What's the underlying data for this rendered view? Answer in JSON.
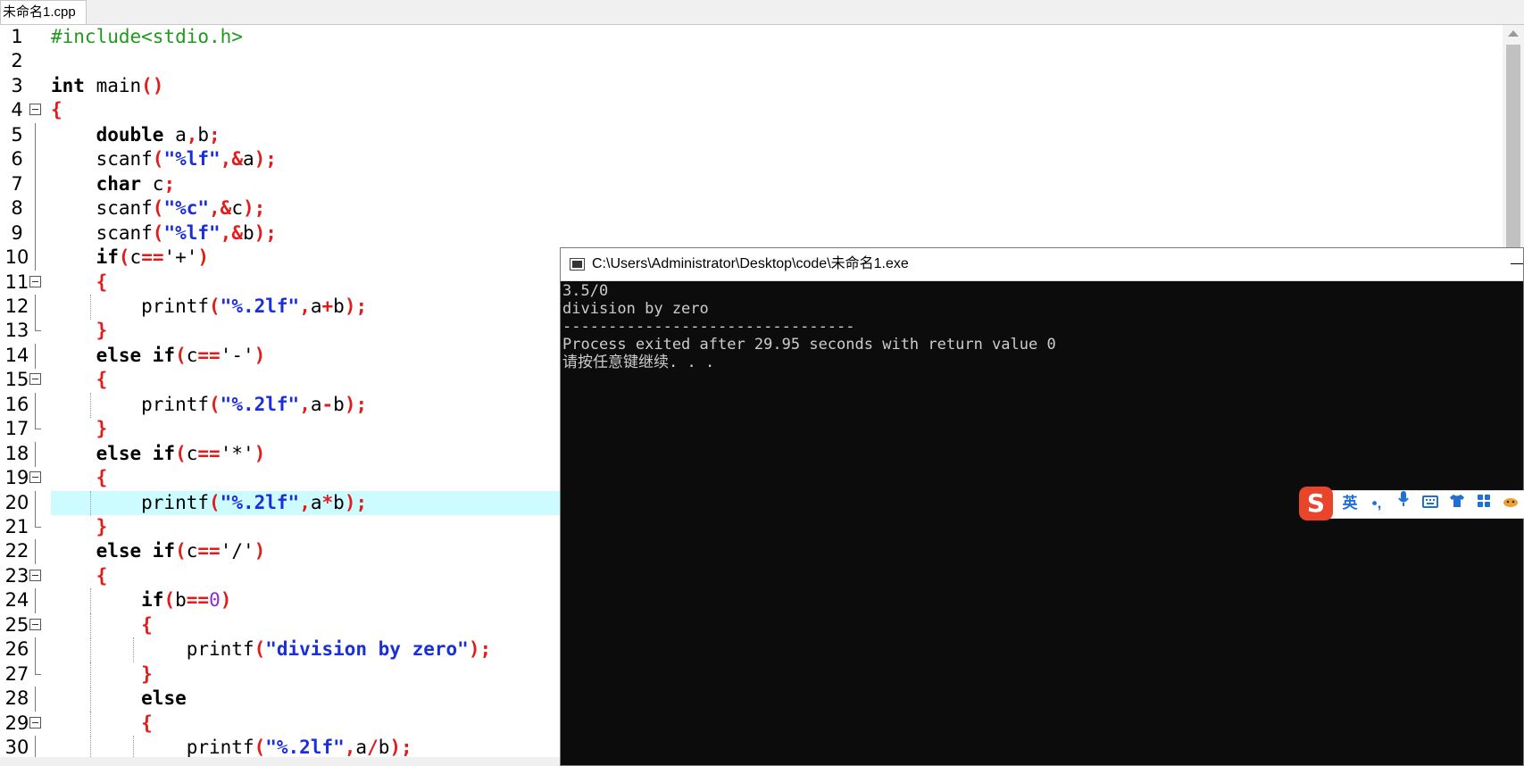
{
  "tab": {
    "label": "未命名1.cpp"
  },
  "editor": {
    "highlight_line": 20,
    "lines": [
      {
        "n": "1",
        "html": "<span class=\"pp\">#include&lt;stdio.h&gt;</span>"
      },
      {
        "n": "2",
        "html": ""
      },
      {
        "n": "3",
        "html": "<span class=\"kw\">int</span> main<span class=\"op\">()</span>"
      },
      {
        "n": "4",
        "html": "<span class=\"op\">{</span>"
      },
      {
        "n": "5",
        "html": "    <span class=\"kw\">double</span> a<span class=\"op\">,</span>b<span class=\"op\">;</span>"
      },
      {
        "n": "6",
        "html": "    scanf<span class=\"op\">(</span><span class=\"str\">\"%lf\"</span><span class=\"op\">,&amp;</span>a<span class=\"op\">);</span>"
      },
      {
        "n": "7",
        "html": "    <span class=\"kw\">char</span> c<span class=\"op\">;</span>"
      },
      {
        "n": "8",
        "html": "    scanf<span class=\"op\">(</span><span class=\"str\">\"%c\"</span><span class=\"op\">,&amp;</span>c<span class=\"op\">);</span>"
      },
      {
        "n": "9",
        "html": "    scanf<span class=\"op\">(</span><span class=\"str\">\"%lf\"</span><span class=\"op\">,&amp;</span>b<span class=\"op\">);</span>"
      },
      {
        "n": "10",
        "html": "    <span class=\"kw\">if</span><span class=\"op\">(</span>c<span class=\"op\">==</span>'+'<span class=\"op\">)</span>"
      },
      {
        "n": "11",
        "html": "    <span class=\"op\">{</span>"
      },
      {
        "n": "12",
        "html": "        printf<span class=\"op\">(</span><span class=\"str\">\"%.2lf\"</span><span class=\"op\">,</span>a<span class=\"op\">+</span>b<span class=\"op\">);</span>"
      },
      {
        "n": "13",
        "html": "    <span class=\"op\">}</span>"
      },
      {
        "n": "14",
        "html": "    <span class=\"kw\">else if</span><span class=\"op\">(</span>c<span class=\"op\">==</span>'-'<span class=\"op\">)</span>"
      },
      {
        "n": "15",
        "html": "    <span class=\"op\">{</span>"
      },
      {
        "n": "16",
        "html": "        printf<span class=\"op\">(</span><span class=\"str\">\"%.2lf\"</span><span class=\"op\">,</span>a<span class=\"op\">-</span>b<span class=\"op\">);</span>"
      },
      {
        "n": "17",
        "html": "    <span class=\"op\">}</span>"
      },
      {
        "n": "18",
        "html": "    <span class=\"kw\">else if</span><span class=\"op\">(</span>c<span class=\"op\">==</span>'*'<span class=\"op\">)</span>"
      },
      {
        "n": "19",
        "html": "    <span class=\"op\">{</span>"
      },
      {
        "n": "20",
        "html": "        printf<span class=\"op\">(</span><span class=\"str\">\"%.2lf\"</span><span class=\"op\">,</span>a<span class=\"op\">*</span>b<span class=\"op\">);</span>"
      },
      {
        "n": "21",
        "html": "    <span class=\"op\">}</span>"
      },
      {
        "n": "22",
        "html": "    <span class=\"kw\">else if</span><span class=\"op\">(</span>c<span class=\"op\">==</span>'/'<span class=\"op\">)</span>"
      },
      {
        "n": "23",
        "html": "    <span class=\"op\">{</span>"
      },
      {
        "n": "24",
        "html": "        <span class=\"kw\">if</span><span class=\"op\">(</span>b<span class=\"op\">==</span><span class=\"num\">0</span><span class=\"op\">)</span>"
      },
      {
        "n": "25",
        "html": "        <span class=\"op\">{</span>"
      },
      {
        "n": "26",
        "html": "            printf<span class=\"op\">(</span><span class=\"str\">\"division by zero\"</span><span class=\"op\">);</span>"
      },
      {
        "n": "27",
        "html": "        <span class=\"op\">}</span>"
      },
      {
        "n": "28",
        "html": "        <span class=\"kw\">else</span>"
      },
      {
        "n": "29",
        "html": "        <span class=\"op\">{</span>"
      },
      {
        "n": "30",
        "html": "            printf<span class=\"op\">(</span><span class=\"str\">\"%.2lf\"</span><span class=\"op\">,</span>a<span class=\"op\">/</span>b<span class=\"op\">);</span>"
      }
    ]
  },
  "console": {
    "title": "C:\\Users\\Administrator\\Desktop\\code\\未命名1.exe",
    "output": "3.5/0\ndivision by zero\n--------------------------------\nProcess exited after 29.95 seconds with return value 0\n请按任意键继续. . ."
  },
  "ime": {
    "logo": "S",
    "lang": "英",
    "punct": "•,",
    "icons": [
      "mic-icon",
      "keyboard-icon",
      "skin-icon",
      "grid-icon",
      "fox-icon"
    ]
  }
}
